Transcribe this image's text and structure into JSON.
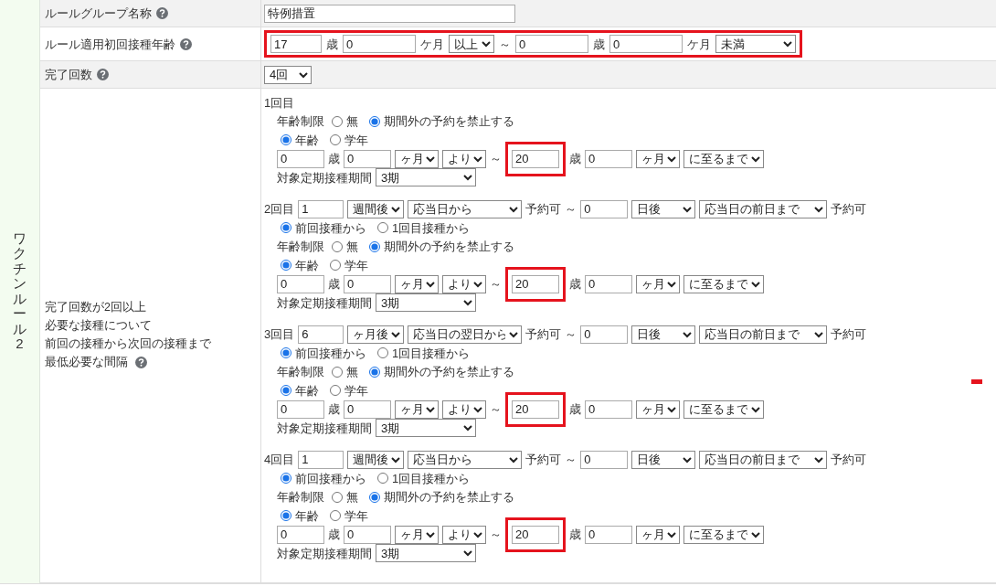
{
  "group_label": "ワクチンルール2",
  "rows": [
    {
      "kind": "text",
      "label": "ルールグループ名称",
      "help": true,
      "value": "特例措置"
    },
    {
      "kind": "age_range",
      "label": "ルール適用初回接種年齢",
      "help": true,
      "highlighted": true,
      "from_years": "17",
      "years_unit": "歳",
      "from_months": "0",
      "months_unit": "ケ月",
      "from_op": "以上",
      "separator": "～",
      "to_years": "0",
      "to_years_unit": "歳",
      "to_months": "0",
      "to_months_unit": "ケ月",
      "to_op": "未満"
    },
    {
      "kind": "count",
      "label": "完了回数",
      "help": true,
      "value": "4回"
    },
    {
      "kind": "doses",
      "label_lines": [
        "完了回数が2回以上",
        "必要な接種について",
        "前回の接種から次回の接種まで",
        "最低必要な間隔"
      ],
      "help": true,
      "doses": [
        {
          "title": "1回目",
          "age_limit": {
            "label": "年齢制限",
            "options": [
              {
                "label": "無",
                "selected": false
              },
              {
                "label": "期間外の予約を禁止する",
                "selected": true
              }
            ]
          },
          "age_type": [
            {
              "label": "年齢",
              "selected": true
            },
            {
              "label": "学年",
              "selected": false
            }
          ],
          "age": {
            "from_years": "0",
            "years_unit": "歳",
            "from_months": "0",
            "months_unit": "ヶ月",
            "from_op": "より",
            "separator": "～",
            "to_years": "20",
            "highlighted": true,
            "to_years_unit": "歳",
            "to_months": "0",
            "to_months_unit": "ヶ月",
            "to_op": "に至るまで"
          },
          "period": {
            "label": "対象定期接種期間",
            "value": "3期"
          }
        },
        {
          "title": "2回目",
          "interval": {
            "amount": "1",
            "unit": "週間後",
            "from": "応当日から",
            "text": "予約可",
            "separator": "～",
            "to_amount": "0",
            "to_unit": "日後",
            "to": "応当日の前日まで",
            "text2": "予約可"
          },
          "basis": [
            {
              "label": "前回接種から",
              "selected": true
            },
            {
              "label": "1回目接種から",
              "selected": false
            }
          ],
          "age_limit": {
            "label": "年齢制限",
            "options": [
              {
                "label": "無",
                "selected": false
              },
              {
                "label": "期間外の予約を禁止する",
                "selected": true
              }
            ]
          },
          "age_type": [
            {
              "label": "年齢",
              "selected": true
            },
            {
              "label": "学年",
              "selected": false
            }
          ],
          "age": {
            "from_years": "0",
            "years_unit": "歳",
            "from_months": "0",
            "months_unit": "ヶ月",
            "from_op": "より",
            "separator": "～",
            "to_years": "20",
            "highlighted": true,
            "to_years_unit": "歳",
            "to_months": "0",
            "to_months_unit": "ヶ月",
            "to_op": "に至るまで"
          },
          "period": {
            "label": "対象定期接種期間",
            "value": "3期"
          }
        },
        {
          "title": "3回目",
          "interval": {
            "amount": "6",
            "unit": "ヶ月後",
            "from": "応当日の翌日から",
            "text": "予約可",
            "separator": "～",
            "to_amount": "0",
            "to_unit": "日後",
            "to": "応当日の前日まで",
            "text2": "予約可"
          },
          "basis": [
            {
              "label": "前回接種から",
              "selected": true
            },
            {
              "label": "1回目接種から",
              "selected": false
            }
          ],
          "age_limit": {
            "label": "年齢制限",
            "options": [
              {
                "label": "無",
                "selected": false
              },
              {
                "label": "期間外の予約を禁止する",
                "selected": true
              }
            ]
          },
          "age_type": [
            {
              "label": "年齢",
              "selected": true
            },
            {
              "label": "学年",
              "selected": false
            }
          ],
          "age": {
            "from_years": "0",
            "years_unit": "歳",
            "from_months": "0",
            "months_unit": "ヶ月",
            "from_op": "より",
            "separator": "～",
            "to_years": "20",
            "highlighted": true,
            "to_years_unit": "歳",
            "to_months": "0",
            "to_months_unit": "ヶ月",
            "to_op": "に至るまで"
          },
          "period": {
            "label": "対象定期接種期間",
            "value": "3期"
          }
        },
        {
          "title": "4回目",
          "interval": {
            "amount": "1",
            "unit": "週間後",
            "from": "応当日から",
            "text": "予約可",
            "separator": "～",
            "to_amount": "0",
            "to_unit": "日後",
            "to": "応当日の前日まで",
            "text2": "予約可"
          },
          "basis": [
            {
              "label": "前回接種から",
              "selected": true
            },
            {
              "label": "1回目接種から",
              "selected": false
            }
          ],
          "age_limit": {
            "label": "年齢制限",
            "options": [
              {
                "label": "無",
                "selected": false
              },
              {
                "label": "期間外の予約を禁止する",
                "selected": true
              }
            ]
          },
          "age_type": [
            {
              "label": "年齢",
              "selected": true
            },
            {
              "label": "学年",
              "selected": false
            }
          ],
          "age": {
            "from_years": "0",
            "years_unit": "歳",
            "from_months": "0",
            "months_unit": "ヶ月",
            "from_op": "より",
            "separator": "～",
            "to_years": "20",
            "highlighted": true,
            "to_years_unit": "歳",
            "to_months": "0",
            "to_months_unit": "ヶ月",
            "to_op": "に至るまで"
          },
          "period": {
            "label": "対象定期接種期間",
            "value": "3期"
          }
        }
      ]
    }
  ]
}
